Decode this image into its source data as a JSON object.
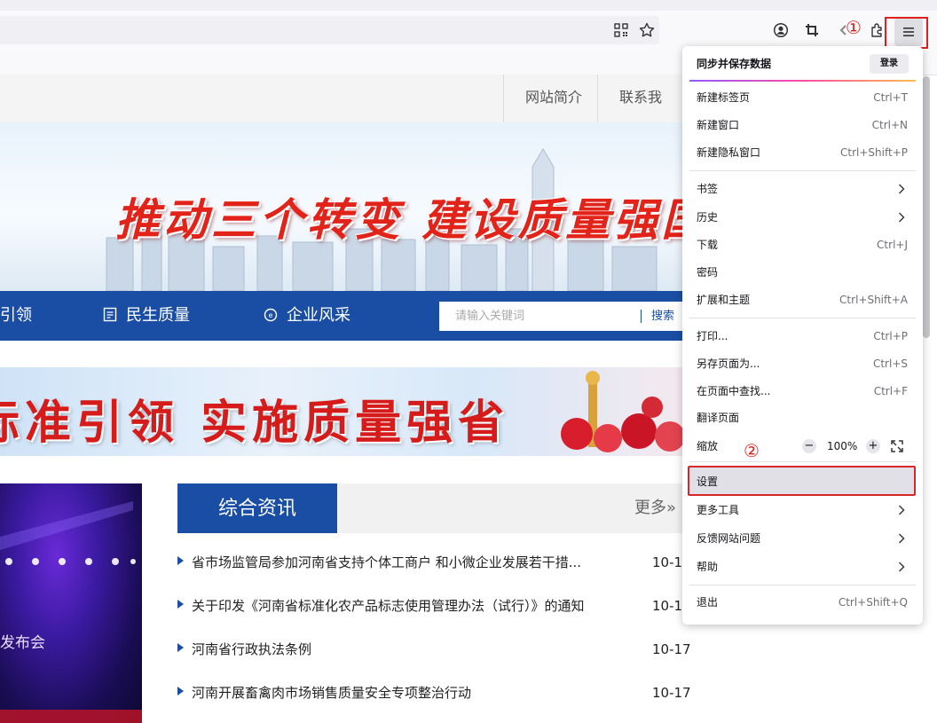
{
  "browser": {
    "menu_button_icon": "hamburger-menu-icon",
    "annotation_1": "①",
    "annotation_2": "②"
  },
  "site": {
    "top_links": [
      "网站简介",
      "联系我们"
    ],
    "banner_slogan": "推动三个转变  建设质量强国",
    "nav_items": [
      "引领",
      "民生质量",
      "企业风采"
    ],
    "search_placeholder": "请输入关键词",
    "search_button": "搜索",
    "banner2_slogan": "标准引领  实施质量强省",
    "photo_caption": "发布会",
    "news_tab": "综合资讯",
    "news_more": "更多»",
    "news": [
      {
        "title": "省市场监管局参加河南省支持个体工商户 和小微企业发展若干措...",
        "date": "10-1"
      },
      {
        "title": "关于印发《河南省标准化农产品标志使用管理办法（试行）》的通知",
        "date": "10-1"
      },
      {
        "title": "河南省行政执法条例",
        "date": "10-17"
      },
      {
        "title": "河南开展畜禽肉市场销售质量安全专项整治行动",
        "date": "10-17"
      }
    ]
  },
  "menu": {
    "sync_title": "同步并保存数据",
    "login": "登录",
    "new_tab": "新建标签页",
    "new_tab_sc": "Ctrl+T",
    "new_window": "新建窗口",
    "new_window_sc": "Ctrl+N",
    "new_private": "新建隐私窗口",
    "new_private_sc": "Ctrl+Shift+P",
    "bookmarks": "书签",
    "history": "历史",
    "downloads": "下载",
    "downloads_sc": "Ctrl+J",
    "passwords": "密码",
    "addons": "扩展和主题",
    "addons_sc": "Ctrl+Shift+A",
    "print": "打印...",
    "print_sc": "Ctrl+P",
    "save_as": "另存页面为...",
    "save_as_sc": "Ctrl+S",
    "find": "在页面中查找...",
    "find_sc": "Ctrl+F",
    "translate": "翻译页面",
    "zoom": "缩放",
    "zoom_minus": "−",
    "zoom_value": "100%",
    "zoom_plus": "+",
    "settings": "设置",
    "more_tools": "更多工具",
    "report": "反馈网站问题",
    "help": "帮助",
    "quit": "退出",
    "quit_sc": "Ctrl+Shift+Q"
  }
}
